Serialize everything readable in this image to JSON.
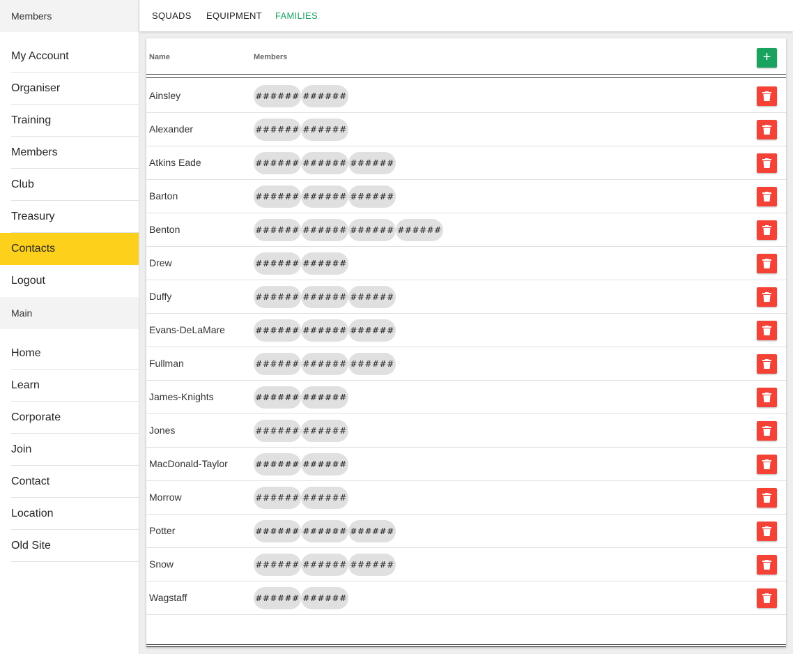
{
  "sidebar": {
    "sections": [
      {
        "header": "Members",
        "items": [
          "My Account",
          "Organiser",
          "Training",
          "Members",
          "Club",
          "Treasury",
          "Contacts",
          "Logout"
        ],
        "active": "Contacts"
      },
      {
        "header": "Main",
        "items": [
          "Home",
          "Learn",
          "Corporate",
          "Join",
          "Contact",
          "Location",
          "Old Site"
        ]
      }
    ]
  },
  "tabs": [
    {
      "label": "SQUADS",
      "active": false
    },
    {
      "label": "EQUIPMENT",
      "active": false
    },
    {
      "label": "FAMILIES",
      "active": true
    }
  ],
  "table": {
    "headers": {
      "name": "Name",
      "members": "Members"
    },
    "add_icon": "plus-icon",
    "delete_icon": "trash-icon",
    "rows": [
      {
        "name": "Ainsley",
        "members": [
          "######",
          "######"
        ]
      },
      {
        "name": "Alexander",
        "members": [
          "######",
          "######"
        ]
      },
      {
        "name": "Atkins Eade",
        "members": [
          "######",
          "######",
          "######"
        ]
      },
      {
        "name": "Barton",
        "members": [
          "######",
          "######",
          "######"
        ]
      },
      {
        "name": "Benton",
        "members": [
          "######",
          "######",
          "######",
          "######"
        ]
      },
      {
        "name": "Drew",
        "members": [
          "######",
          "######"
        ]
      },
      {
        "name": "Duffy",
        "members": [
          "######",
          "######",
          "######"
        ]
      },
      {
        "name": "Evans-DeLaMare",
        "members": [
          "######",
          "######",
          "######"
        ]
      },
      {
        "name": "Fullman",
        "members": [
          "######",
          "######",
          "######"
        ]
      },
      {
        "name": "James-Knights",
        "members": [
          "######",
          "######"
        ]
      },
      {
        "name": "Jones",
        "members": [
          "######",
          "######"
        ]
      },
      {
        "name": "MacDonald-Taylor",
        "members": [
          "######",
          "######"
        ]
      },
      {
        "name": "Morrow",
        "members": [
          "######",
          "######"
        ]
      },
      {
        "name": "Potter",
        "members": [
          "######",
          "######",
          "######"
        ]
      },
      {
        "name": "Snow",
        "members": [
          "######",
          "######",
          "######"
        ]
      },
      {
        "name": "Wagstaff",
        "members": [
          "######",
          "######"
        ]
      }
    ]
  },
  "colors": {
    "active_nav": "#fdd01c",
    "active_tab": "#1aa25f",
    "add_button": "#1aa25f",
    "delete_button": "#f44336",
    "chip": "#e0e0e0"
  }
}
